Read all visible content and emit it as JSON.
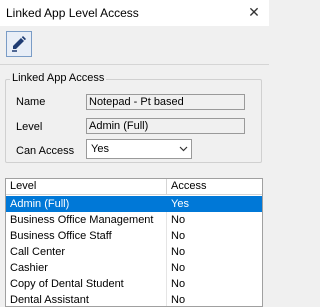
{
  "window": {
    "title": "Linked App Level Access"
  },
  "toolbar": {
    "edit_icon": "pencil-icon"
  },
  "group": {
    "legend": "Linked App Access",
    "name_label": "Name",
    "name_value": "Notepad - Pt based",
    "level_label": "Level",
    "level_value": "Admin (Full)",
    "access_label": "Can Access",
    "access_value": "Yes"
  },
  "table": {
    "columns": [
      "Level",
      "Access"
    ],
    "rows": [
      {
        "level": "Admin (Full)",
        "access": "Yes",
        "selected": true
      },
      {
        "level": "Business Office Management",
        "access": "No"
      },
      {
        "level": "Business Office Staff",
        "access": "No"
      },
      {
        "level": "Call Center",
        "access": "No"
      },
      {
        "level": "Cashier",
        "access": "No"
      },
      {
        "level": "Copy of Dental Student",
        "access": "No"
      },
      {
        "level": "Dental Assistant",
        "access": "No"
      }
    ]
  },
  "colors": {
    "selection": "#0078d7",
    "icon": "#1f3c73"
  }
}
